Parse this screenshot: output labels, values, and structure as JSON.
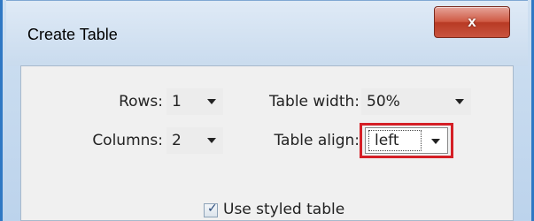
{
  "window": {
    "title": "Create Table",
    "close_label": "x"
  },
  "form": {
    "rows_label": "Rows:",
    "rows_value": "1",
    "columns_label": "Columns:",
    "columns_value": "2",
    "table_width_label": "Table width:",
    "table_width_value": "50%",
    "table_align_label": "Table align:",
    "table_align_value": "left",
    "styled_table_label": "Use styled table",
    "styled_table_checked": true
  },
  "colors": {
    "highlight": "#d51f26",
    "window_border": "#2f78c4"
  }
}
